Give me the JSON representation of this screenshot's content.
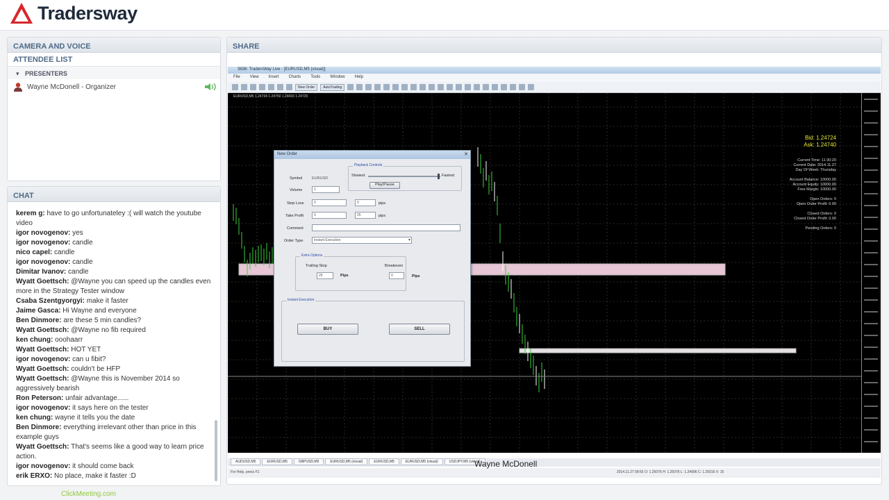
{
  "brand": {
    "logo_text": "Tradersway"
  },
  "left": {
    "camera_title": "CAMERA AND VOICE",
    "attendee_title": "ATTENDEE LIST",
    "presenters_label": "PRESENTERS",
    "attendee_name": "Wayne McDonell - Organizer",
    "chat_title": "CHAT",
    "clickmeeting": "ClickMeeting.com"
  },
  "chat": [
    {
      "user": "kerem g:",
      "text": " have to go unfortunateley :( will watch the youtube video"
    },
    {
      "user": "igor novogenov:",
      "text": " yes"
    },
    {
      "user": "igor novogenov:",
      "text": " candle"
    },
    {
      "user": "nico capel:",
      "text": " candle"
    },
    {
      "user": "igor novogenov:",
      "text": " candle"
    },
    {
      "user": "Dimitar Ivanov:",
      "text": " candle"
    },
    {
      "user": "Wyatt Goettsch:",
      "text": " @Wayne you can speed up the candles even more in the Strategy Tester window"
    },
    {
      "user": "Csaba Szentgyorgyi:",
      "text": " make it faster"
    },
    {
      "user": "Jaime Gasca:",
      "text": " Hi Wayne and everyone"
    },
    {
      "user": "Ben Dinmore:",
      "text": " are these 5 min candles?"
    },
    {
      "user": "Wyatt Goettsch:",
      "text": " @Wayne no fib required"
    },
    {
      "user": "ken chung:",
      "text": " ooohaarr"
    },
    {
      "user": "Wyatt Goettsch:",
      "text": " HOT YET"
    },
    {
      "user": "igor novogenov:",
      "text": " can u fibit?"
    },
    {
      "user": "Wyatt Goettsch:",
      "text": " couldn't be HFP"
    },
    {
      "user": "Wyatt Goettsch:",
      "text": " @Wayne this is November 2014 so aggressively bearish"
    },
    {
      "user": "Ron Peterson:",
      "text": " unfair advantage......"
    },
    {
      "user": "igor novogenov:",
      "text": " it says here on the tester"
    },
    {
      "user": "ken chung:",
      "text": " wayne it tells you the date"
    },
    {
      "user": "Ben Dinmore:",
      "text": " everything irrelevant other than price in this example guys"
    },
    {
      "user": "Wyatt Goettsch:",
      "text": " That's seems like a good way to learn price action."
    },
    {
      "user": "igor novogenov:",
      "text": " it should come back"
    },
    {
      "user": "erik ERXO:",
      "text": " No place, make it faster :D"
    }
  ],
  "share": {
    "title": "SHARE",
    "mt_title": "3836: TradersWay Live - [EURUSD,M5 (visual)]",
    "menu": [
      "File",
      "View",
      "Insert",
      "Charts",
      "Tools",
      "Window",
      "Help"
    ],
    "toolbar_new_order": "New Order",
    "toolbar_autotrading": "AutoTrading",
    "chart_header": "EURUSD,M5  1.24734 1.24750 1.24693 1.24720",
    "bid": "Bid:  1.24724",
    "ask": "Ask:  1.24740",
    "info_lines": [
      "Current Time:  11:30:20",
      "Current Date:  2014.11.27",
      "Day Of Week:  Thursday",
      "",
      "Account Balance:  10000.00",
      "Account Equity:  10000.00",
      "Free Margin:  10000.00",
      "",
      "Open Orders:  0",
      "Open Order Profit:  0.00",
      "",
      "Closed Orders:  0",
      "Closed Order Profit:  0.00",
      "",
      "Pending Orders:  0"
    ],
    "tabs": [
      "AUDUSD,M5",
      "EURUSD,M5",
      "GBPUSD,M5",
      "EURUSD,M5 (visual)",
      "EURUSD,M5",
      "EURUSD,M5 (visual)",
      "USDJPY,M5 (visual)"
    ],
    "status_left": "For Help, press F1",
    "status_right": "2014.11.27 08:55   O: 1.25076   H: 1.25076   L: 1.24996   C: 1.25016   V: 15",
    "caption": "Wayne McDonell"
  },
  "dialog": {
    "title": "New Order",
    "symbol_label": "Symbol",
    "symbol_value": "EURUSD",
    "volume_label": "Volume",
    "volume_value": "1",
    "stoploss_label": "Stop Loss",
    "stoploss_value": "0",
    "stoploss_pips": "0",
    "takeprofit_label": "Take Profit",
    "takeprofit_value": "0",
    "takeprofit_pips": "25",
    "pips": "pips",
    "comment_label": "Comment",
    "ordertype_label": "Order Type",
    "ordertype_value": "Instant Execution",
    "playback_title": "Playback Controls",
    "slowest": "Slowest",
    "fastest": "Fastest",
    "play_pause": "Play/Pause",
    "extra_title": "Extra Options",
    "trailing_label": "Trailing Stop",
    "trailing_value": "25",
    "breakeven_label": "Breakeven",
    "breakeven_value": "0",
    "pips_cap": "Pips",
    "instant_title": "Instant Execution",
    "buy": "BUY",
    "sell": "SELL"
  }
}
